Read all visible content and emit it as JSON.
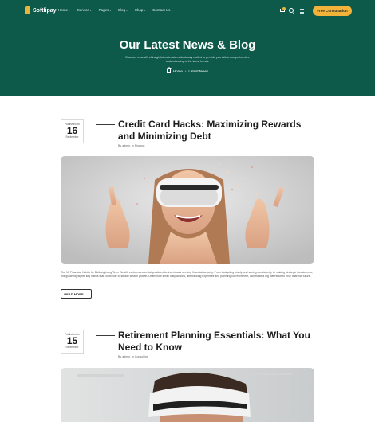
{
  "nav": {
    "brand": "Softlipay",
    "items": [
      {
        "label": "Home",
        "has_dropdown": true
      },
      {
        "label": "Service",
        "has_dropdown": true
      },
      {
        "label": "Pages",
        "has_dropdown": true
      },
      {
        "label": "Blog",
        "has_dropdown": true
      },
      {
        "label": "Shop",
        "has_dropdown": true
      },
      {
        "label": "Contact Us",
        "has_dropdown": false
      }
    ],
    "cta_label": "Free Consultation",
    "icons": [
      "cart-icon",
      "search-icon",
      "grid-menu-icon"
    ],
    "accent": "#f3b23a"
  },
  "hero": {
    "title": "Our Latest News & Blog",
    "subtitle": "Discover a wealth of insightful materials meticulously crafted to provide you with a comprehensive understanding of the latest trends.",
    "breadcrumb": {
      "home": "Home",
      "current": "Latest News"
    },
    "bg_color": "#0d5a4a"
  },
  "posts": [
    {
      "date_label": "Published on",
      "day": "16",
      "month": "September",
      "title": "Credit Card Hacks: Maximizing Rewards and Minimizing Debt",
      "meta": "By admin, in Finance",
      "excerpt": "The 10 Financial Habits for Building Long-Term Wealth explores essential practices for individuals seeking financial security. From budgeting wisely and saving consistently to making strategic investments, this guide highlights key habits that contribute to steady wealth growth. Learn how small daily actions, like tracking expenses and planning for retirement, can make a big difference to your financial future.",
      "read_more": "READ MORE"
    },
    {
      "date_label": "Published on",
      "day": "15",
      "month": "September",
      "title": "Retirement Planning Essentials: What You Need to Know",
      "meta": "By admin, in Consulting"
    }
  ]
}
